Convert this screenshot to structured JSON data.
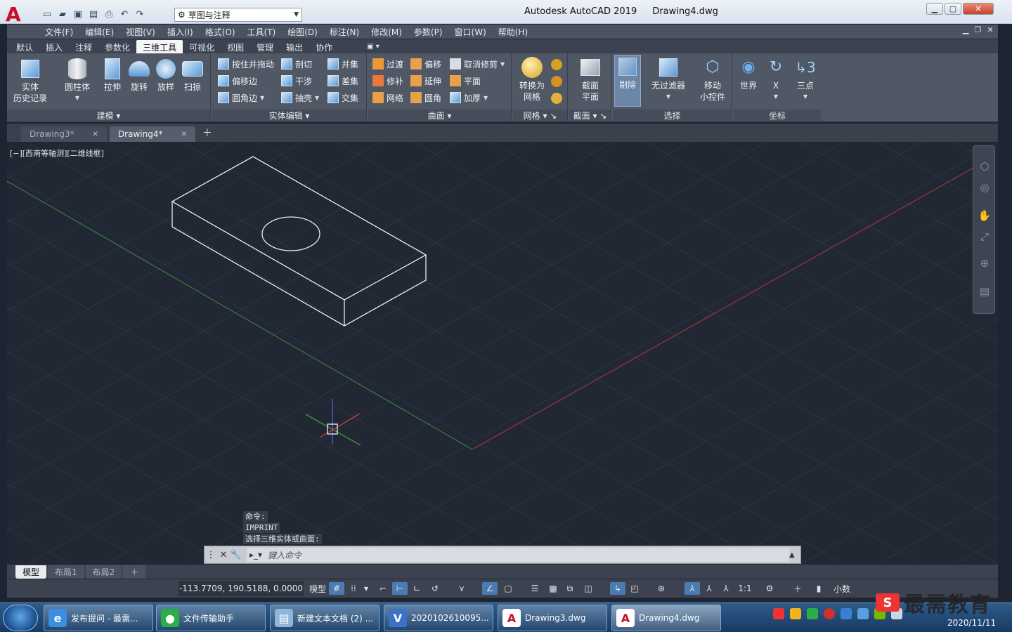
{
  "app": {
    "logo": "A",
    "title": "Autodesk AutoCAD 2019",
    "document": "Drawing4.dwg",
    "workspace": "草图与注释"
  },
  "menu": [
    "文件(F)",
    "编辑(E)",
    "视图(V)",
    "插入(I)",
    "格式(O)",
    "工具(T)",
    "绘图(D)",
    "标注(N)",
    "修改(M)",
    "参数(P)",
    "窗口(W)",
    "帮助(H)"
  ],
  "ribbon_tabs": [
    "默认",
    "插入",
    "注释",
    "参数化",
    "三维工具",
    "可视化",
    "视图",
    "管理",
    "输出",
    "协作"
  ],
  "ribbon_active_tab": "三维工具",
  "ribbon": {
    "modeling": {
      "title": "建模",
      "buttons": [
        "实体\n历史记录",
        "圆柱体",
        "拉伸",
        "旋转",
        "放样",
        "扫掠"
      ]
    },
    "solid_edit": {
      "title": "实体编辑",
      "items": [
        "按住并拖动",
        "偏移边",
        "圆角边",
        "剖切",
        "干涉",
        "抽壳",
        "并集",
        "差集",
        "交集"
      ]
    },
    "surface": {
      "title": "曲面",
      "items": [
        "过渡",
        "修补",
        "网络",
        "偏移",
        "延伸",
        "圆角",
        "取消修剪",
        "平面",
        "加厚"
      ]
    },
    "mesh": {
      "title": "网格",
      "button": "转换为\n网格"
    },
    "section": {
      "title": "截面",
      "button": "截面\n平面"
    },
    "selection": {
      "title": "选择",
      "buttons": [
        "剔除",
        "无过滤器",
        "移动\n小控件"
      ]
    },
    "coordinates": {
      "title": "坐标",
      "buttons": [
        "世界",
        "X",
        "三点"
      ]
    }
  },
  "doc_tabs": [
    "Drawing3*",
    "Drawing4*"
  ],
  "viewport_label": "[−][西南等轴测][二维线框]",
  "command_history": [
    "命令:",
    "IMPRINT",
    "选择三维实体或曲面:"
  ],
  "command_placeholder": "键入命令",
  "layout_tabs": [
    "模型",
    "布局1",
    "布局2"
  ],
  "status": {
    "coords": "-113.7709, 190.5188, 0.0000",
    "model": "模型",
    "scale": "1:1",
    "units": "小数"
  },
  "taskbar": {
    "items": [
      {
        "label": "发布提问 - 最需...",
        "icon": "ie-icon",
        "color": "#3b8ee0"
      },
      {
        "label": "文件传输助手",
        "icon": "wechat-icon",
        "color": "#2aae45"
      },
      {
        "label": "新建文本文档 (2) ...",
        "icon": "notepad-icon",
        "color": "#8fb6d8"
      },
      {
        "label": "2020102610095...",
        "icon": "vs-icon",
        "color": "#3a73c6"
      },
      {
        "label": "Drawing3.dwg",
        "icon": "autocad-icon",
        "color": "#c8102e"
      },
      {
        "label": "Drawing4.dwg",
        "icon": "autocad-icon",
        "color": "#c8102e"
      }
    ],
    "date": "2020/11/11"
  },
  "watermark": "最需教育",
  "colors": {
    "viewport": "#212834",
    "x_axis": "#b03a3a",
    "y_axis": "#3e8a3e",
    "wireframe": "#e8ecf0",
    "accent": "#4c7bb3"
  }
}
